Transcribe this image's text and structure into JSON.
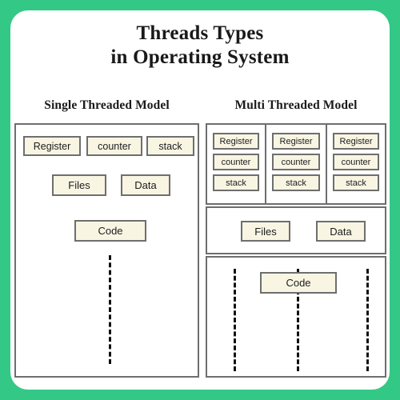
{
  "theme": {
    "background_green": "#34C886",
    "card_background": "#FFFFFF",
    "box_fill": "#F9F5E3",
    "box_border": "#6E6E6E",
    "text_color": "#191919"
  },
  "header": {
    "title_line1": "Threads Types",
    "title_line2": "in Operating System"
  },
  "single_model": {
    "heading": "Single Threaded Model",
    "row_top": [
      {
        "label": "Register"
      },
      {
        "label": "counter"
      },
      {
        "label": "stack"
      }
    ],
    "row_mid": [
      {
        "label": "Files"
      },
      {
        "label": "Data"
      }
    ],
    "code": {
      "label": "Code"
    }
  },
  "multi_model": {
    "heading": "Multi Threaded Model",
    "threads": [
      {
        "rows": [
          "Register",
          "counter",
          "stack"
        ]
      },
      {
        "rows": [
          "Register",
          "counter",
          "stack"
        ]
      },
      {
        "rows": [
          "Register",
          "counter",
          "stack"
        ]
      }
    ],
    "shared_row": [
      {
        "label": "Files"
      },
      {
        "label": "Data"
      }
    ],
    "code": {
      "label": "Code"
    }
  }
}
